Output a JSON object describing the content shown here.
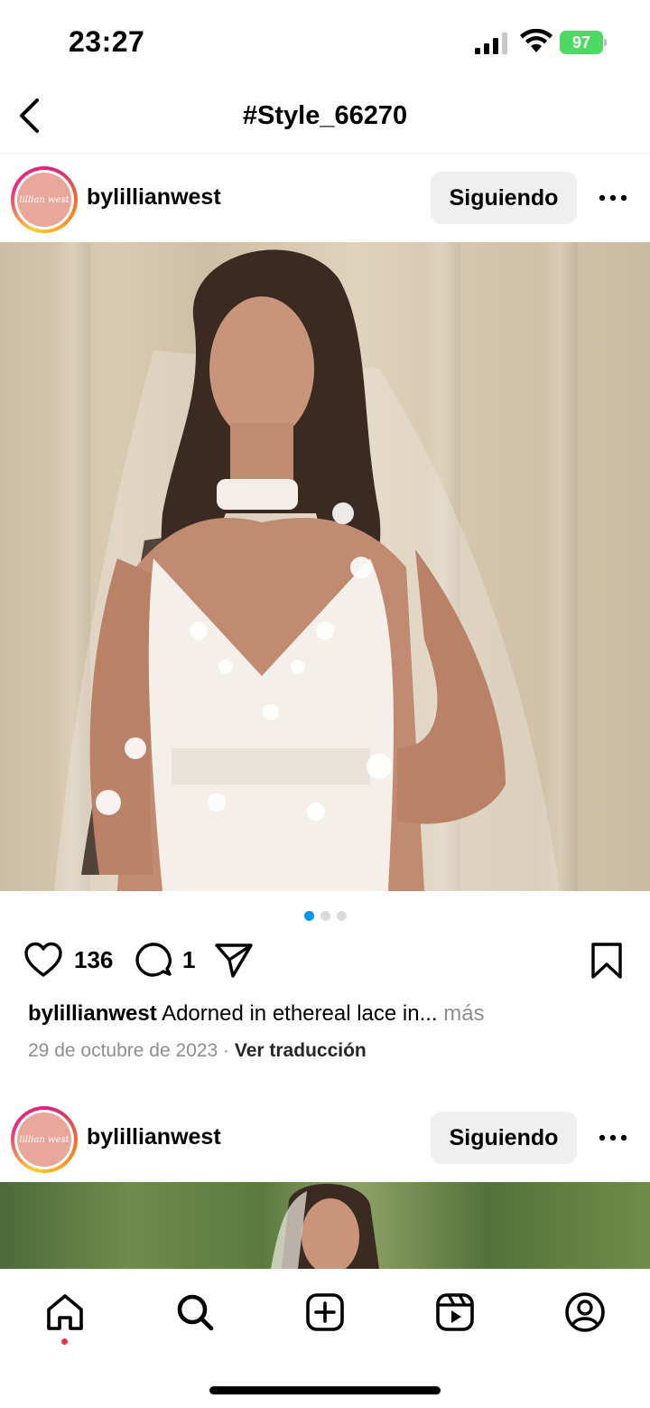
{
  "status_bar": {
    "time": "23:27",
    "battery": "97"
  },
  "header": {
    "title": "#Style_66270",
    "back_icon": "chevron-left-icon"
  },
  "posts": [
    {
      "username": "bylillianwest",
      "avatar_text": "lillian west",
      "follow_label": "Siguiendo",
      "likes": "136",
      "comments": "1",
      "caption_user": "bylillianwest",
      "caption_text": " Adorned in ethereal lace in...",
      "caption_more": " más",
      "date": "29 de octubre de 2023",
      "separator": " · ",
      "translate_label": "Ver traducción",
      "carousel": {
        "count": 3,
        "active": 1
      }
    },
    {
      "username": "bylillianwest",
      "avatar_text": "lillian west",
      "follow_label": "Siguiendo"
    }
  ],
  "tab_bar": {
    "items": [
      "home-icon",
      "search-icon",
      "create-icon",
      "reels-icon",
      "profile-icon"
    ],
    "active": "home",
    "notification_color": "#ff3040"
  },
  "colors": {
    "accent": "#0095f6",
    "follow_bg": "#efefef",
    "muted": "#8e8e8e"
  }
}
